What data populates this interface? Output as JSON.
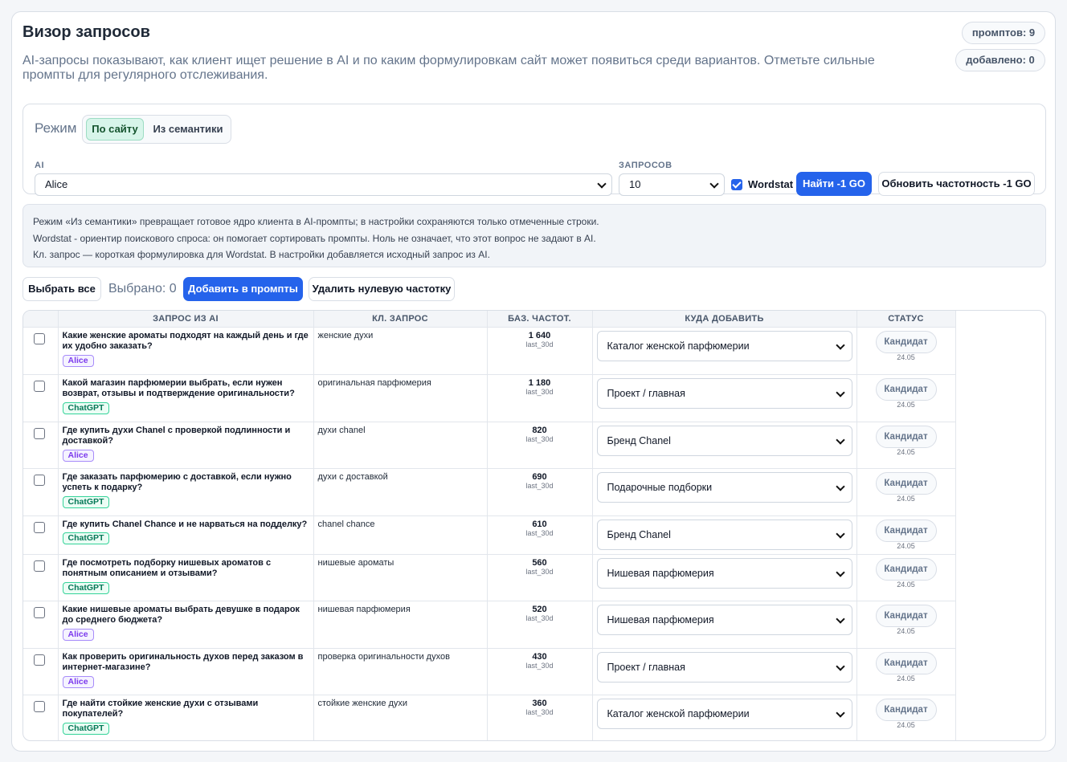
{
  "header": {
    "title": "Визор запросов",
    "subtitle": "AI-запросы показывают, как клиент ищет решение в AI и по каким формулировкам сайт может появиться среди вариантов. Отметьте сильные промпты для регулярного отслеживания.",
    "prompts_badge": "промптов: 9",
    "added_badge": "добавлено: 0"
  },
  "controls": {
    "mode_label": "Режим",
    "mode_on_site": "По сайту",
    "mode_semantics": "Из семантики",
    "ai_label": "AI",
    "ai_value": "Alice",
    "count_label": "ЗАПРОСОВ",
    "count_value": "10",
    "wordstat_label": "Wordstat",
    "find_button": "Найти -1 GO",
    "refresh_button": "Обновить частотность -1 GO"
  },
  "info": {
    "line1": "Режим «Из семантики» превращает готовое ядро клиента в AI-промпты; в настройки сохраняются только отмеченные строки.",
    "line2": "Wordstat - ориентир поискового спроса: он помогает сортировать промпты. Ноль не означает, что этот вопрос не задают в AI.",
    "line3": "Кл. запрос — короткая формулировка для Wordstat. В настройки добавляется исходный запрос из AI."
  },
  "actions": {
    "select_all": "Выбрать все",
    "selected": "Выбрано: 0",
    "add_prompts": "Добавить в промпты",
    "remove_zero": "Удалить нулевую частотку"
  },
  "table": {
    "headers": [
      "ЗАПРОС ИЗ AI",
      "КЛ. ЗАПРОС",
      "БАЗ. ЧАСТОТ.",
      "КУДА ДОБАВИТЬ",
      "СТАТУС"
    ],
    "rows": [
      {
        "query": "Какие женские ароматы подходят на каждый день и где их удобно заказать?",
        "ai": "Alice",
        "keyword": "женские духи",
        "freq": "1 640",
        "period": "last_30d",
        "target": "Каталог женской парфюмерии",
        "status": "Кандидат",
        "date": "24.05"
      },
      {
        "query": "Какой магазин парфюмерии выбрать, если нужен возврат, отзывы и подтверждение оригинальности?",
        "ai": "ChatGPT",
        "keyword": "оригинальная парфюмерия",
        "freq": "1 180",
        "period": "last_30d",
        "target": "Проект / главная",
        "status": "Кандидат",
        "date": "24.05"
      },
      {
        "query": "Где купить духи Chanel с проверкой подлинности и доставкой?",
        "ai": "Alice",
        "keyword": "духи chanel",
        "freq": "820",
        "period": "last_30d",
        "target": "Бренд Chanel",
        "status": "Кандидат",
        "date": "24.05"
      },
      {
        "query": "Где заказать парфюмерию с доставкой, если нужно успеть к подарку?",
        "ai": "ChatGPT",
        "keyword": "духи с доставкой",
        "freq": "690",
        "period": "last_30d",
        "target": "Подарочные подборки",
        "status": "Кандидат",
        "date": "24.05"
      },
      {
        "query": "Где купить Chanel Chance и не нарваться на подделку?",
        "ai": "ChatGPT",
        "keyword": "chanel chance",
        "freq": "610",
        "period": "last_30d",
        "target": "Бренд Chanel",
        "status": "Кандидат",
        "date": "24.05"
      },
      {
        "query": "Где посмотреть подборку нишевых ароматов с понятным описанием и отзывами?",
        "ai": "ChatGPT",
        "keyword": "нишевые ароматы",
        "freq": "560",
        "period": "last_30d",
        "target": "Нишевая парфюмерия",
        "status": "Кандидат",
        "date": "24.05"
      },
      {
        "query": "Какие нишевые ароматы выбрать девушке в подарок до среднего бюджета?",
        "ai": "Alice",
        "keyword": "нишевая парфюмерия",
        "freq": "520",
        "period": "last_30d",
        "target": "Нишевая парфюмерия",
        "status": "Кандидат",
        "date": "24.05"
      },
      {
        "query": "Как проверить оригинальность духов перед заказом в интернет-магазине?",
        "ai": "Alice",
        "keyword": "проверка оригинальности духов",
        "freq": "430",
        "period": "last_30d",
        "target": "Проект / главная",
        "status": "Кандидат",
        "date": "24.05"
      },
      {
        "query": "Где найти стойкие женские духи с отзывами покупателей?",
        "ai": "ChatGPT",
        "keyword": "стойкие женские духи",
        "freq": "360",
        "period": "last_30d",
        "target": "Каталог женской парфюмерии",
        "status": "Кандидат",
        "date": "24.05"
      }
    ]
  }
}
